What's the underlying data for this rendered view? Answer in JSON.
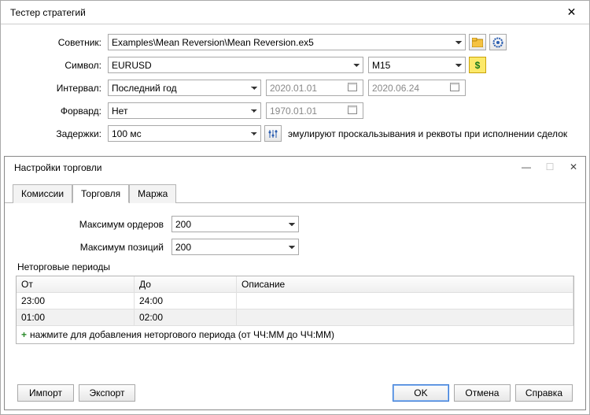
{
  "tester": {
    "title": "Тестер стратегий",
    "labels": {
      "advisor": "Советник:",
      "symbol": "Символ:",
      "interval": "Интервал:",
      "forward": "Форвард:",
      "delays": "Задержки:"
    },
    "advisor_value": "Examples\\Mean Reversion\\Mean Reversion.ex5",
    "symbol_value": "EURUSD",
    "timeframe_value": "M15",
    "interval_value": "Последний год",
    "date_from": "2020.01.01",
    "date_to": "2020.06.24",
    "forward_value": "Нет",
    "forward_date": "1970.01.01",
    "delays_value": "100 мс",
    "delays_hint": "эмулируют проскальзывания и реквоты при исполнении сделок"
  },
  "settings": {
    "title": "Настройки торговли",
    "tabs": {
      "commissions": "Комиссии",
      "trading": "Торговля",
      "margin": "Маржа"
    },
    "labels": {
      "max_orders": "Максимум ордеров",
      "max_positions": "Максимум позиций",
      "nontrading": "Неторговые периоды"
    },
    "values": {
      "max_orders": "200",
      "max_positions": "200"
    },
    "table": {
      "col_from": "От",
      "col_to": "До",
      "col_desc": "Описание",
      "rows": [
        {
          "from": "23:00",
          "to": "24:00",
          "desc": ""
        },
        {
          "from": "01:00",
          "to": "02:00",
          "desc": ""
        }
      ],
      "add_hint": "нажмите для добавления неторгового периода (от ЧЧ:ММ до ЧЧ:ММ)"
    },
    "buttons": {
      "import": "Импорт",
      "export": "Экспорт",
      "ok": "OK",
      "cancel": "Отмена",
      "help": "Справка"
    }
  },
  "icons": {
    "folder": "folder-icon",
    "gear": "gear-icon",
    "currency": "currency-icon",
    "sliders": "sliders-icon",
    "calendar": "calendar-icon"
  }
}
